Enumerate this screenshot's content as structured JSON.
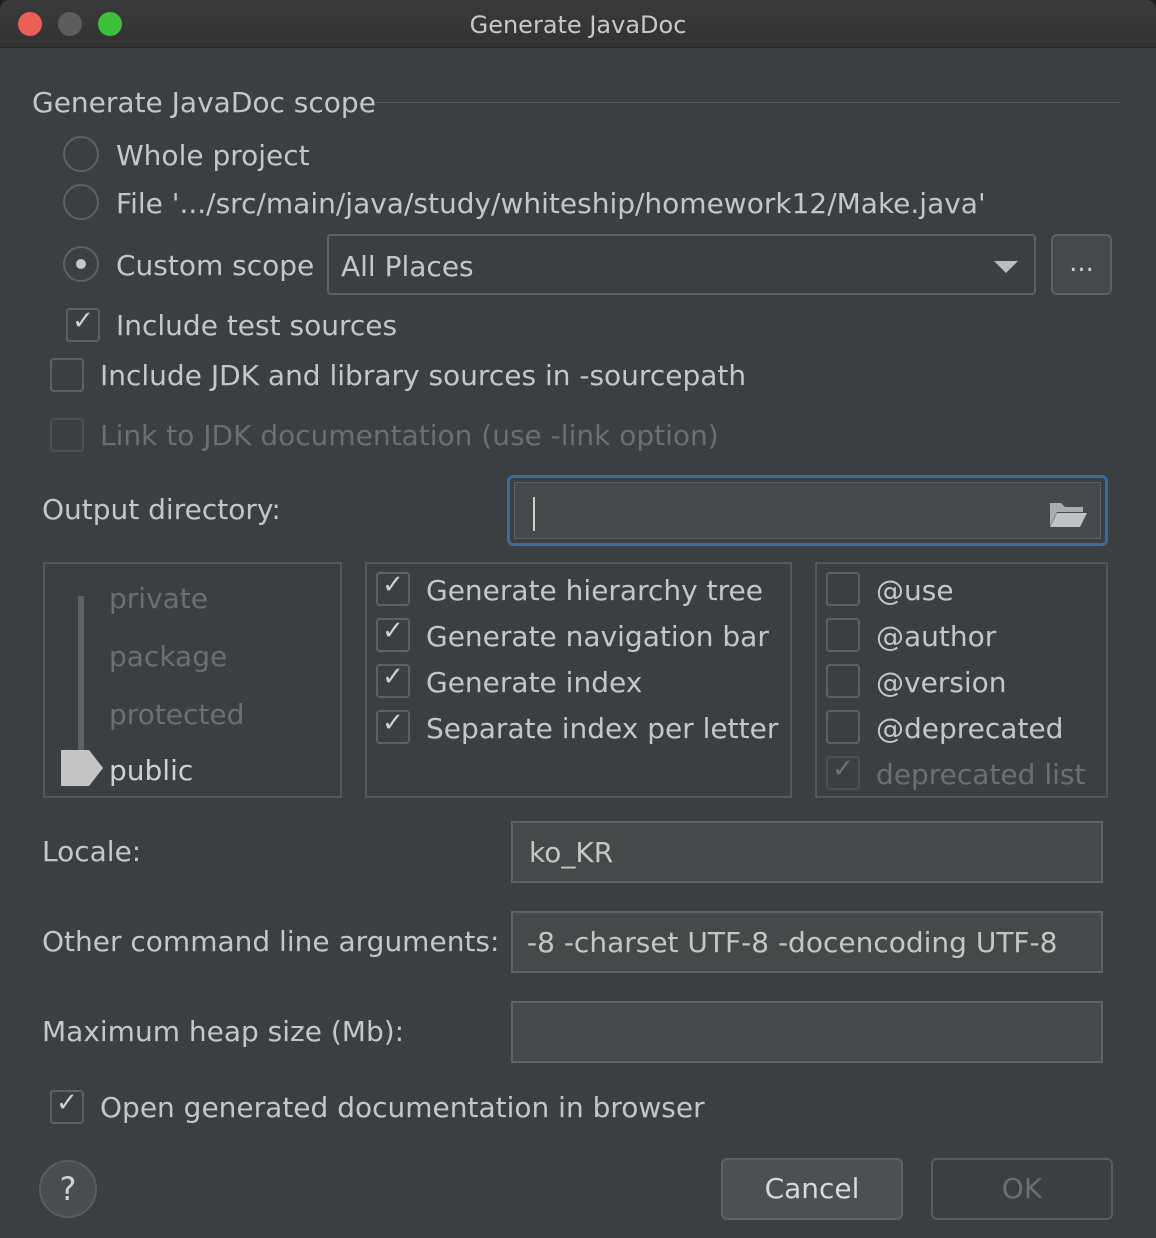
{
  "window": {
    "title": "Generate JavaDoc"
  },
  "scope": {
    "title": "Generate JavaDoc scope",
    "whole_project": "Whole project",
    "file": "File '.../src/main/java/study/whiteship/homework12/Make.java'",
    "custom_scope": "Custom scope",
    "custom_scope_value": "All Places",
    "ellipsis": "...",
    "selected": "custom_scope",
    "include_test_sources": {
      "label": "Include test sources",
      "checked": true
    }
  },
  "include_jdk": {
    "label": "Include JDK and library sources in -sourcepath",
    "checked": false
  },
  "link_jdk": {
    "label": "Link to JDK documentation (use -link option)",
    "checked": false,
    "disabled": true
  },
  "output_directory": {
    "label": "Output directory:",
    "value": ""
  },
  "visibility": {
    "levels": [
      "private",
      "package",
      "protected",
      "public"
    ],
    "selected": "public"
  },
  "generation_options": [
    {
      "label": "Generate hierarchy tree",
      "checked": true
    },
    {
      "label": "Generate navigation bar",
      "checked": true
    },
    {
      "label": "Generate index",
      "checked": true
    },
    {
      "label": "Separate index per letter",
      "checked": true
    }
  ],
  "tag_options": [
    {
      "label": "@use",
      "checked": false
    },
    {
      "label": "@author",
      "checked": false
    },
    {
      "label": "@version",
      "checked": false
    },
    {
      "label": "@deprecated",
      "checked": false
    },
    {
      "label": "deprecated list",
      "checked": true,
      "disabled": true
    }
  ],
  "locale": {
    "label": "Locale:",
    "value": "ko_KR"
  },
  "other_args": {
    "label": "Other command line arguments:",
    "value": "-8 -charset UTF-8 -docencoding UTF-8"
  },
  "max_heap": {
    "label": "Maximum heap size (Mb):",
    "value": ""
  },
  "open_browser": {
    "label": "Open generated documentation in browser",
    "checked": true
  },
  "buttons": {
    "help": "?",
    "cancel": "Cancel",
    "ok": "OK"
  },
  "icons": {
    "check": "checkmark-icon",
    "folder": "folder-open-icon",
    "dropdown": "chevron-down-icon"
  },
  "colors": {
    "background": "#3c3f41",
    "focus_border": "#3c6a9e",
    "text": "#c6c6c6",
    "disabled_text": "#6d6e70"
  }
}
